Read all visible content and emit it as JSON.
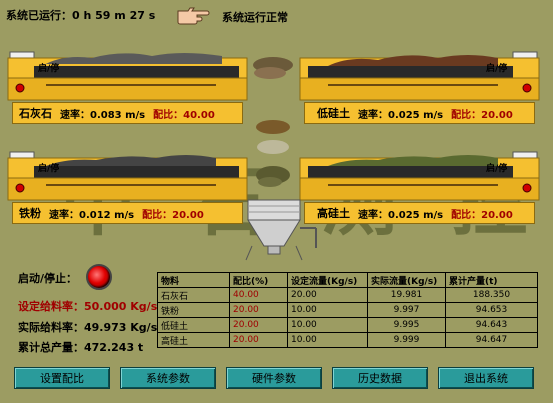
{
  "header": {
    "runtime": "系统已运行：0 h 59 m 27 s",
    "status": "系统运行正常"
  },
  "watermark": "中 石 测 控",
  "start_label": "启/停",
  "feeders": [
    {
      "name": "石灰石",
      "speed_label": "速率：",
      "speed": "0.083 m/s",
      "ratio_label": "配比：",
      "ratio": "40.00"
    },
    {
      "name": "低硅土",
      "speed_label": "速率：",
      "speed": "0.025 m/s",
      "ratio_label": "配比：",
      "ratio": "20.00"
    },
    {
      "name": "铁粉",
      "speed_label": "速率：",
      "speed": "0.012 m/s",
      "ratio_label": "配比：",
      "ratio": "20.00"
    },
    {
      "name": "高硅土",
      "speed_label": "速率：",
      "speed": "0.025 m/s",
      "ratio_label": "配比：",
      "ratio": "20.00"
    }
  ],
  "controls": {
    "start_stop_label": "启动/停止：",
    "set_rate_label": "设定给料率：",
    "set_rate_value": "50.000 Kg/s",
    "actual_rate_label": "实际给料率：",
    "actual_rate_value": "49.973 Kg/s",
    "total_label": "累计总产量：",
    "total_value": "472.243 t",
    "led_color": "#e00000"
  },
  "table": {
    "headers": [
      "物料",
      "配比(%)",
      "设定流量(Kg/s)",
      "实际流量(Kg/s)",
      "累计产量(t)"
    ],
    "rows": [
      [
        "石灰石",
        "40.00",
        "20.00",
        "19.981",
        "188.350"
      ],
      [
        "铁粉",
        "20.00",
        "10.00",
        "9.997",
        "94.653"
      ],
      [
        "低硅土",
        "20.00",
        "10.00",
        "9.995",
        "94.643"
      ],
      [
        "高硅土",
        "20.00",
        "10.00",
        "9.999",
        "94.647"
      ]
    ]
  },
  "buttons": {
    "set_ratio": "设置配比",
    "system_params": "系统参数",
    "hardware_params": "硬件参数",
    "history": "历史数据",
    "exit": "退出系统"
  },
  "colors": {
    "background": "#9c9c62",
    "feeder_yellow": "#f5c030",
    "button_teal": "#2a9b9b",
    "ratio_red": "#a00000"
  }
}
